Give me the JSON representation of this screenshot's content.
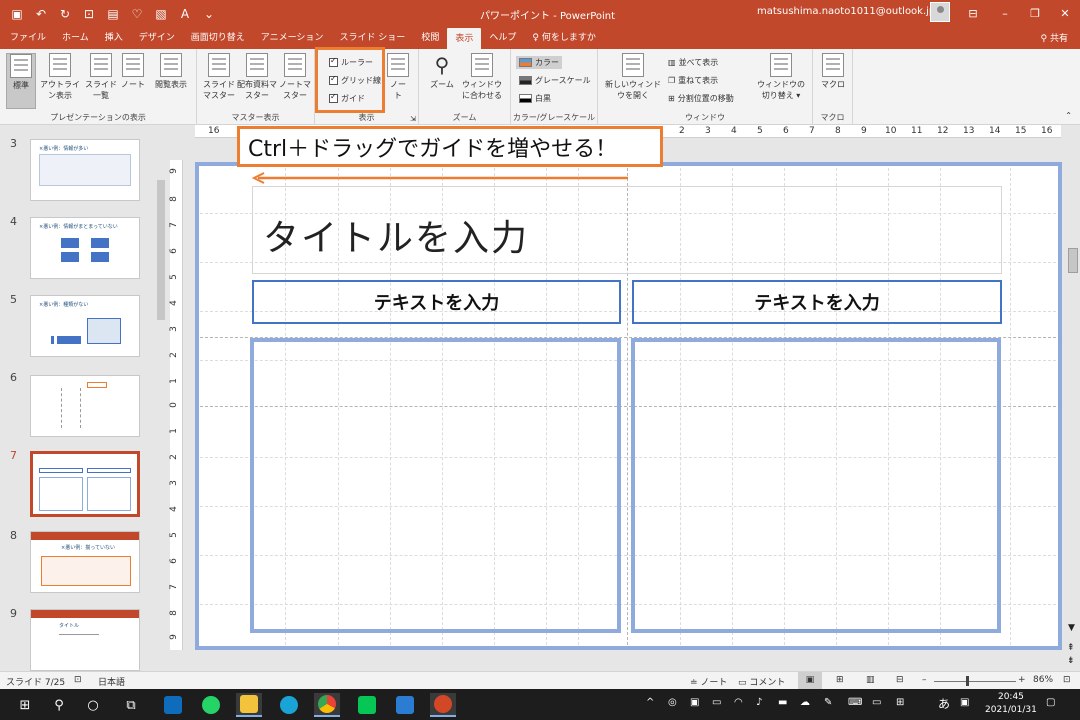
{
  "window": {
    "title": "パワーポイント - PowerPoint",
    "user": "matsushima.naoto1011@outlook.jp"
  },
  "tabs": [
    "ファイル",
    "ホーム",
    "挿入",
    "デザイン",
    "画面切り替え",
    "アニメーション",
    "スライド ショー",
    "校閲",
    "表示",
    "ヘルプ",
    "何をしますか"
  ],
  "active_tab": "表示",
  "share_label": "共有",
  "ribbon": {
    "presentation_view": {
      "label": "プレゼンテーションの表示",
      "buttons": [
        "標準",
        "アウトライン表示",
        "スライド一覧",
        "ノート",
        "閲覧表示"
      ]
    },
    "master_view": {
      "label": "マスター表示",
      "buttons": [
        "スライドマスター",
        "配布資料マスター",
        "ノートマスター"
      ]
    },
    "show": {
      "label": "表示",
      "options": [
        "ルーラー",
        "グリッド線",
        "ガイド"
      ],
      "notes_button": "ノート"
    },
    "zoom": {
      "label": "ズーム",
      "buttons": [
        "ズーム",
        "ウィンドウに合わせる"
      ]
    },
    "color": {
      "label": "カラー/グレースケール",
      "options": [
        "カラー",
        "グレースケール",
        "白黒"
      ]
    },
    "window": {
      "label": "ウィンドウ",
      "new_window": "新しいウィンドウを開く",
      "options": [
        "並べて表示",
        "重ねて表示",
        "分割位置の移動"
      ],
      "switch": "ウィンドウの切り替え"
    },
    "macro": {
      "label": "マクロ",
      "button": "マクロ"
    }
  },
  "ruler": {
    "h_ticks": [
      "16",
      "15",
      "14",
      "13",
      "12",
      "11",
      "10",
      "9",
      "8",
      "7",
      "6",
      "5",
      "4",
      "3",
      "2",
      "1",
      "0",
      "1",
      "2",
      "3",
      "4",
      "5",
      "6",
      "7",
      "8",
      "9",
      "10",
      "11",
      "12",
      "13",
      "14",
      "15",
      "16"
    ],
    "v_ticks": [
      "9",
      "8",
      "7",
      "6",
      "5",
      "4",
      "3",
      "2",
      "1",
      "0",
      "1",
      "2",
      "3",
      "4",
      "5",
      "6",
      "7",
      "8",
      "9"
    ]
  },
  "slides": [
    {
      "num": "3",
      "title": "×悪い例：情報が多い"
    },
    {
      "num": "4",
      "title": "×悪い例：情報がまとまっていない"
    },
    {
      "num": "5",
      "title": "×悪い例：種類がない"
    },
    {
      "num": "6",
      "title": ""
    },
    {
      "num": "7",
      "title": ""
    },
    {
      "num": "8",
      "title": "×悪い例：揃っていない"
    },
    {
      "num": "9",
      "title": "タイトル"
    }
  ],
  "current_slide": "7",
  "callout": "Ctrl＋ドラッグでガイドを増やせる！",
  "slide": {
    "title_placeholder": "タイトルを入力",
    "header_left": "テキストを入力",
    "header_right": "テキストを入力"
  },
  "status": {
    "slide_count": "スライド 7/25",
    "language": "日本語",
    "notes": "ノート",
    "comments": "コメント",
    "zoom": "86%"
  },
  "taskbar": {
    "ime": "あ",
    "time": "20:45",
    "date": "2021/01/31"
  },
  "colors": {
    "accent": "#c1482b",
    "highlight": "#ed7d31",
    "placeholder_border": "#8faadc",
    "header_border": "#4472c4"
  }
}
